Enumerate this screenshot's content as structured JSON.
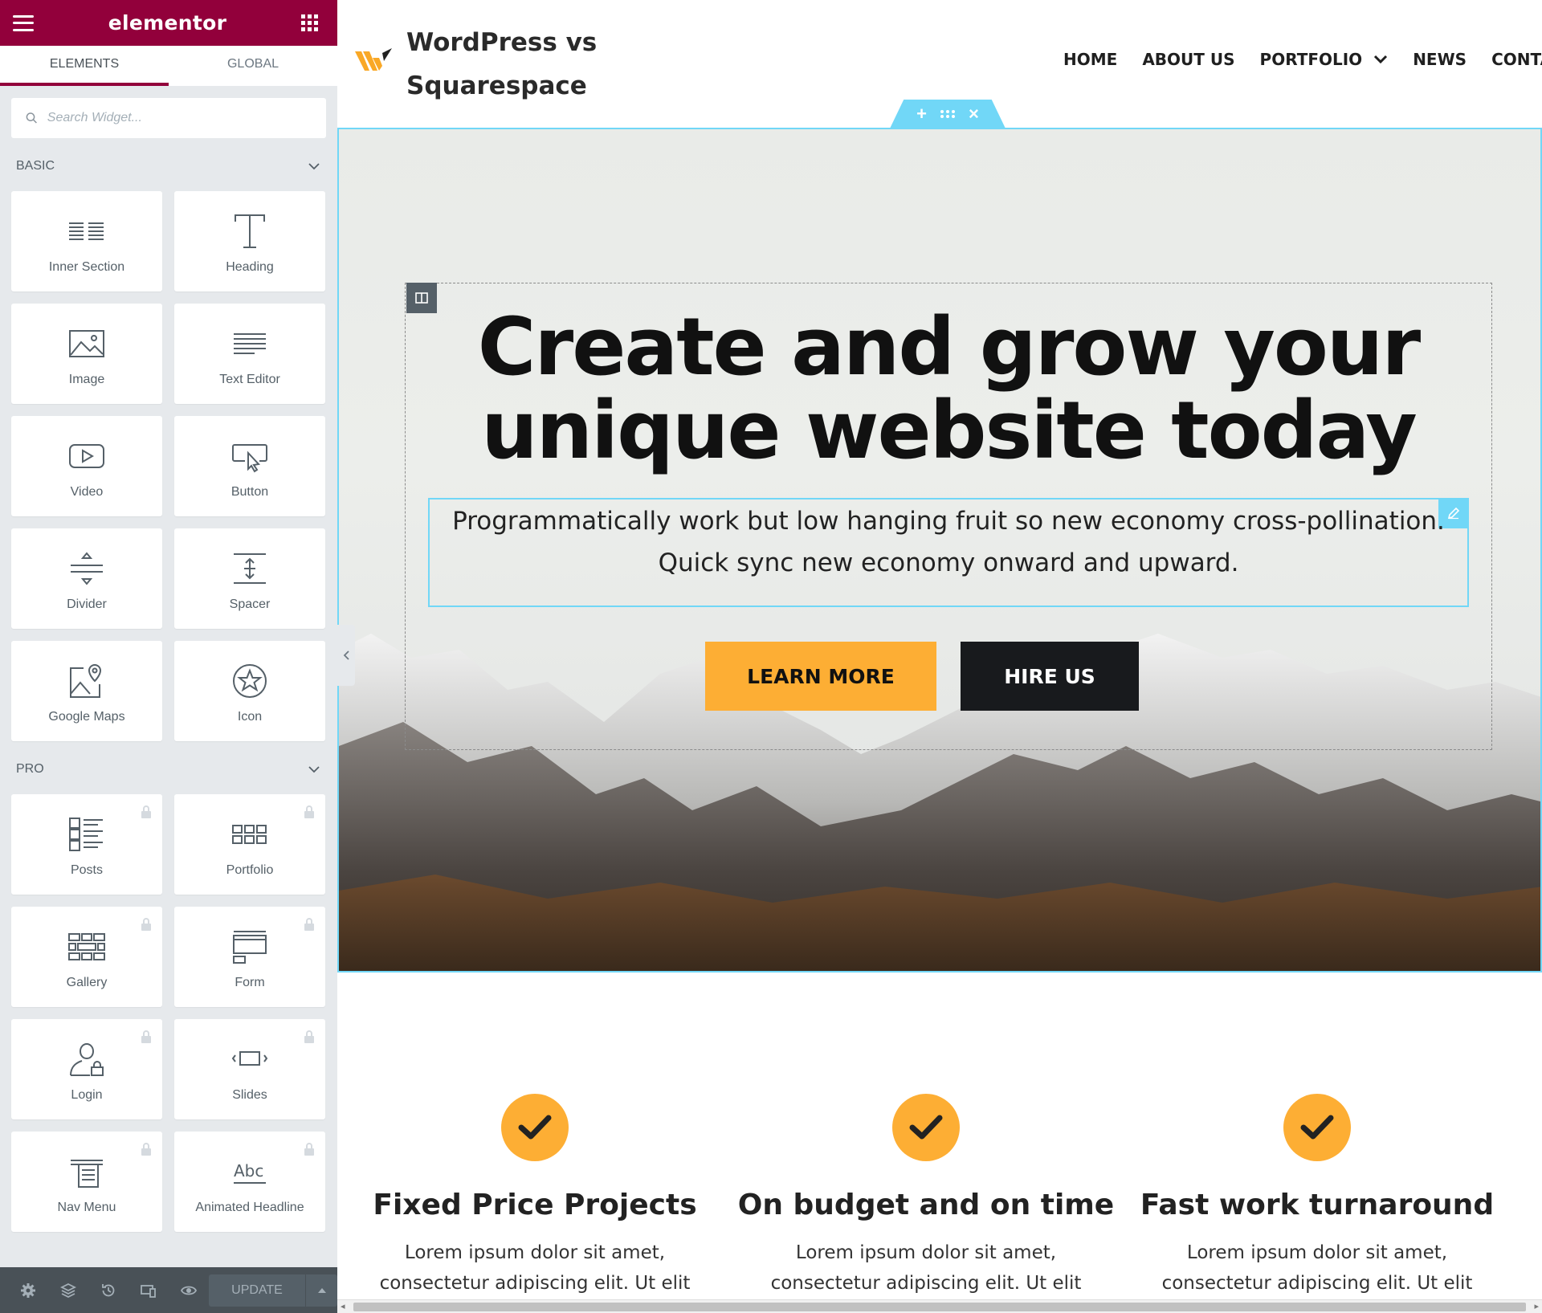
{
  "editor": {
    "logo": "elementor",
    "tabs": [
      {
        "label": "ELEMENTS",
        "active": true
      },
      {
        "label": "GLOBAL",
        "active": false
      }
    ],
    "search": {
      "placeholder": "Search Widget..."
    },
    "categories": {
      "basic": {
        "label": "BASIC",
        "widgets": [
          {
            "label": "Inner Section",
            "icon": "inner-section-icon"
          },
          {
            "label": "Heading",
            "icon": "heading-icon"
          },
          {
            "label": "Image",
            "icon": "image-icon"
          },
          {
            "label": "Text Editor",
            "icon": "text-editor-icon"
          },
          {
            "label": "Video",
            "icon": "video-icon"
          },
          {
            "label": "Button",
            "icon": "button-icon"
          },
          {
            "label": "Divider",
            "icon": "divider-icon"
          },
          {
            "label": "Spacer",
            "icon": "spacer-icon"
          },
          {
            "label": "Google Maps",
            "icon": "google-maps-icon"
          },
          {
            "label": "Icon",
            "icon": "star-icon"
          }
        ]
      },
      "pro": {
        "label": "PRO",
        "widgets": [
          {
            "label": "Posts",
            "icon": "posts-icon",
            "locked": true
          },
          {
            "label": "Portfolio",
            "icon": "portfolio-icon",
            "locked": true
          },
          {
            "label": "Gallery",
            "icon": "gallery-icon",
            "locked": true
          },
          {
            "label": "Form",
            "icon": "form-icon",
            "locked": true
          },
          {
            "label": "Login",
            "icon": "login-icon",
            "locked": true
          },
          {
            "label": "Slides",
            "icon": "slides-icon",
            "locked": true
          },
          {
            "label": "Nav Menu",
            "icon": "nav-menu-icon",
            "locked": true
          },
          {
            "label": "Animated Headline",
            "icon": "animated-headline-icon",
            "locked": true
          }
        ]
      }
    },
    "footer": {
      "update_label": "UPDATE"
    },
    "colors": {
      "brand": "#92003b",
      "panel_bg": "#e6e9ec",
      "footer_bg": "#495157",
      "selection": "#71d7f7"
    }
  },
  "site": {
    "title": "WordPress vs Squarespace",
    "nav": [
      "HOME",
      "ABOUT US",
      "PORTFOLIO",
      "NEWS",
      "CONTACT"
    ],
    "hero": {
      "title": "Create and grow your unique website today",
      "subtitle_line1": "Programmatically work but low hanging fruit so new economy cross-pollination.",
      "subtitle_line2": "Quick sync new economy onward and upward.",
      "learn_more": "LEARN MORE",
      "hire_us": "HIRE US"
    },
    "features": [
      {
        "title": "Fixed Price Projects",
        "text_line1": "Lorem ipsum dolor sit amet,",
        "text_line2": "consectetur adipiscing elit. Ut elit"
      },
      {
        "title": "On budget and on time",
        "text_line1": "Lorem ipsum dolor sit amet,",
        "text_line2": "consectetur adipiscing elit. Ut elit"
      },
      {
        "title": "Fast work turnaround",
        "text_line1": "Lorem ipsum dolor sit amet,",
        "text_line2": "consectetur adipiscing elit. Ut elit"
      }
    ],
    "colors": {
      "accent": "#fdae34",
      "dark": "#181a1d"
    }
  }
}
